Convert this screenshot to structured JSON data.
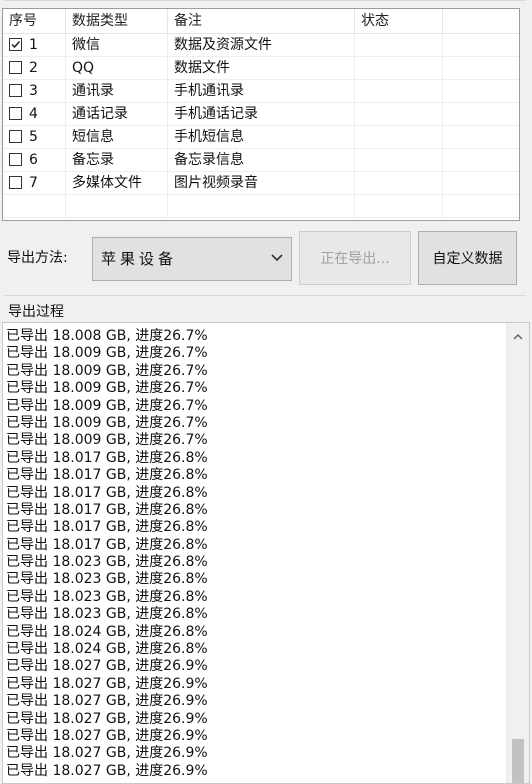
{
  "list": {
    "columns": [
      "序号",
      "数据类型",
      "备注",
      "状态"
    ],
    "rows": [
      {
        "checked": true,
        "seq": "1",
        "type": "微信",
        "note": "数据及资源文件",
        "status": ""
      },
      {
        "checked": false,
        "seq": "2",
        "type": "QQ",
        "note": "数据文件",
        "status": ""
      },
      {
        "checked": false,
        "seq": "3",
        "type": "通讯录",
        "note": "手机通讯录",
        "status": ""
      },
      {
        "checked": false,
        "seq": "4",
        "type": "通话记录",
        "note": "手机通话记录",
        "status": ""
      },
      {
        "checked": false,
        "seq": "5",
        "type": "短信息",
        "note": "手机短信息",
        "status": ""
      },
      {
        "checked": false,
        "seq": "6",
        "type": "备忘录",
        "note": "备忘录信息",
        "status": ""
      },
      {
        "checked": false,
        "seq": "7",
        "type": "多媒体文件",
        "note": "图片视频录音",
        "status": ""
      }
    ]
  },
  "export": {
    "method_label": "导出方法:",
    "method_value": "苹果设备",
    "exporting_button": "正在导出...",
    "custom_button": "自定义数据"
  },
  "process": {
    "title": "导出过程",
    "lines": [
      "已导出 18.008 GB, 进度26.7%",
      "已导出 18.009 GB, 进度26.7%",
      "已导出 18.009 GB, 进度26.7%",
      "已导出 18.009 GB, 进度26.7%",
      "已导出 18.009 GB, 进度26.7%",
      "已导出 18.009 GB, 进度26.7%",
      "已导出 18.009 GB, 进度26.7%",
      "已导出 18.017 GB, 进度26.8%",
      "已导出 18.017 GB, 进度26.8%",
      "已导出 18.017 GB, 进度26.8%",
      "已导出 18.017 GB, 进度26.8%",
      "已导出 18.017 GB, 进度26.8%",
      "已导出 18.017 GB, 进度26.8%",
      "已导出 18.023 GB, 进度26.8%",
      "已导出 18.023 GB, 进度26.8%",
      "已导出 18.023 GB, 进度26.8%",
      "已导出 18.023 GB, 进度26.8%",
      "已导出 18.024 GB, 进度26.8%",
      "已导出 18.024 GB, 进度26.8%",
      "已导出 18.027 GB, 进度26.9%",
      "已导出 18.027 GB, 进度26.9%",
      "已导出 18.027 GB, 进度26.9%",
      "已导出 18.027 GB, 进度26.9%",
      "已导出 18.027 GB, 进度26.9%",
      "已导出 18.027 GB, 进度26.9%",
      "已导出 18.027 GB, 进度26.9%"
    ]
  }
}
